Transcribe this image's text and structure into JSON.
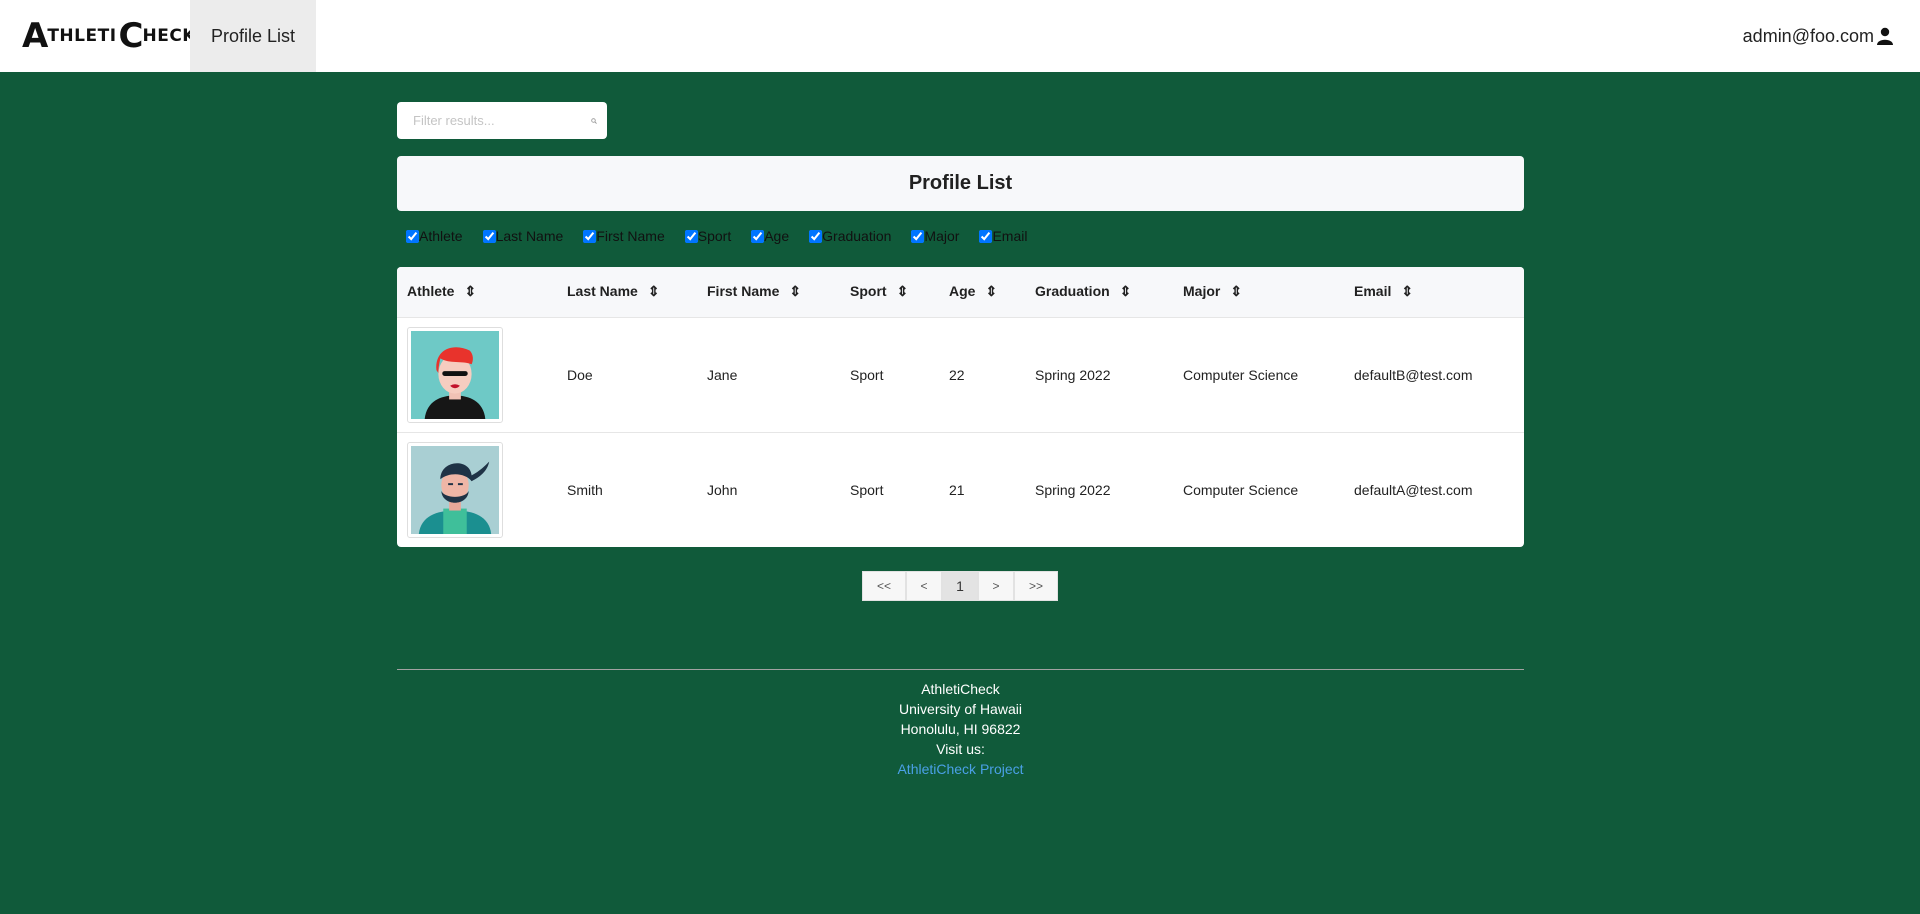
{
  "nav": {
    "brand": {
      "a": "A",
      "thleti": "THLETI",
      "c": "C",
      "heck": "HECK"
    },
    "item_profile_list": "Profile List",
    "user_email": "admin@foo.com"
  },
  "filter": {
    "placeholder": "Filter results..."
  },
  "page_title": "Profile List",
  "column_toggles": [
    "Athlete",
    "Last Name",
    "First Name",
    "Sport",
    "Age",
    "Graduation",
    "Major",
    "Email"
  ],
  "table": {
    "headers": [
      "Athlete",
      "Last Name",
      "First Name",
      "Sport",
      "Age",
      "Graduation",
      "Major",
      "Email"
    ],
    "rows": [
      {
        "last": "Doe",
        "first": "Jane",
        "sport": "Sport",
        "age": "22",
        "graduation": "Spring 2022",
        "major": "Computer Science",
        "email": "defaultB@test.com"
      },
      {
        "last": "Smith",
        "first": "John",
        "sport": "Sport",
        "age": "21",
        "graduation": "Spring 2022",
        "major": "Computer Science",
        "email": "defaultA@test.com"
      }
    ]
  },
  "pagination": {
    "first": "<<",
    "prev": "<",
    "page": "1",
    "next": ">",
    "last": ">>"
  },
  "footer": {
    "line1": "AthletiCheck",
    "line2": "University of Hawaii",
    "line3": "Honolulu, HI 96822",
    "line4": "Visit us:",
    "link": "AthletiCheck Project"
  },
  "colors": {
    "background": "#105a3a",
    "link": "#4aa0e6"
  }
}
